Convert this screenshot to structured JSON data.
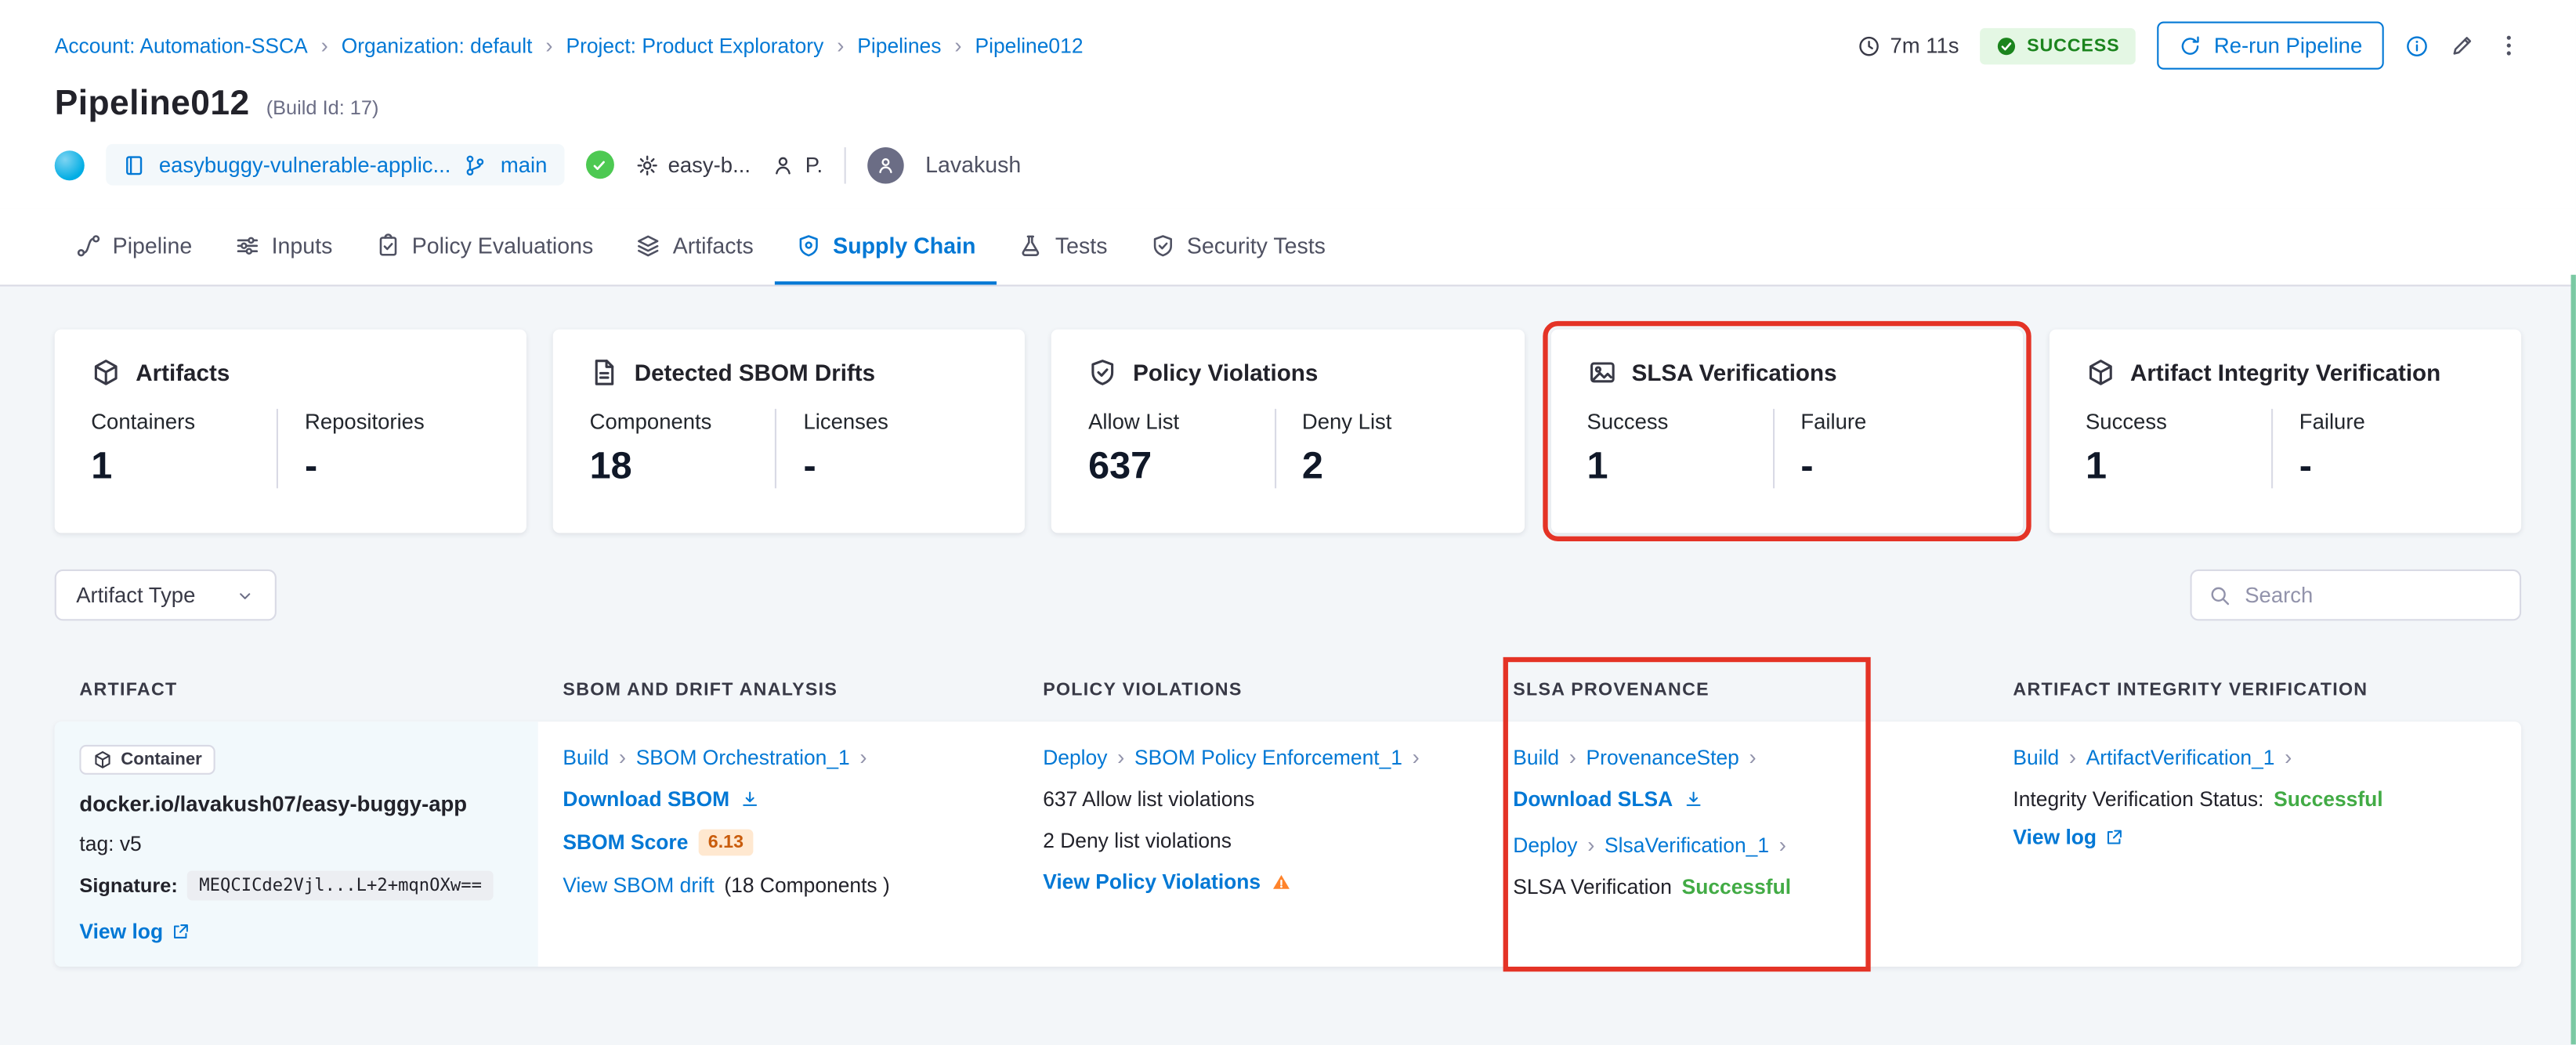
{
  "ui": {
    "chevron": "›"
  },
  "colors": {
    "accent_blue": "#0278d5",
    "success_green": "#42ab45",
    "highlight_red": "#e43326",
    "warning_orange": "#ff832b"
  },
  "breadcrumb": {
    "items": [
      "Account: Automation-SSCA",
      "Organization: default",
      "Project: Product Exploratory",
      "Pipelines",
      "Pipeline012"
    ]
  },
  "header": {
    "duration": "7m 11s",
    "status_badge": "SUCCESS",
    "rerun_button": "Re-run Pipeline",
    "title": "Pipeline012",
    "build_id": "(Build Id: 17)",
    "repo_name": "easybuggy-vulnerable-applic...",
    "branch_name": "main",
    "trigger_label": "easy-b...",
    "trigger_type": "P.",
    "user_name": "Lavakush"
  },
  "tabs": [
    {
      "label": "Pipeline"
    },
    {
      "label": "Inputs"
    },
    {
      "label": "Policy Evaluations"
    },
    {
      "label": "Artifacts"
    },
    {
      "label": "Supply Chain"
    },
    {
      "label": "Tests"
    },
    {
      "label": "Security Tests"
    }
  ],
  "cards": [
    {
      "title": "Artifacts",
      "stats": [
        {
          "label": "Containers",
          "value": "1"
        },
        {
          "label": "Repositories",
          "value": "-"
        }
      ]
    },
    {
      "title": "Detected SBOM Drifts",
      "stats": [
        {
          "label": "Components",
          "value": "18"
        },
        {
          "label": "Licenses",
          "value": "-"
        }
      ]
    },
    {
      "title": "Policy Violations",
      "stats": [
        {
          "label": "Allow List",
          "value": "637"
        },
        {
          "label": "Deny List",
          "value": "2"
        }
      ]
    },
    {
      "title": "SLSA Verifications",
      "stats": [
        {
          "label": "Success",
          "value": "1"
        },
        {
          "label": "Failure",
          "value": "-"
        }
      ]
    },
    {
      "title": "Artifact Integrity Verification",
      "stats": [
        {
          "label": "Success",
          "value": "1"
        },
        {
          "label": "Failure",
          "value": "-"
        }
      ]
    }
  ],
  "filters": {
    "artifact_type": "Artifact Type",
    "search_placeholder": "Search"
  },
  "table": {
    "headers": [
      "ARTIFACT",
      "SBOM AND DRIFT ANALYSIS",
      "POLICY VIOLATIONS",
      "SLSA PROVENANCE",
      "ARTIFACT INTEGRITY VERIFICATION"
    ],
    "row": {
      "artifact": {
        "type_badge": "Container",
        "image": "docker.io/lavakush07/easy-buggy-app",
        "tag": "tag: v5",
        "signature_label": "Signature:",
        "signature_value": "MEQCICde2Vjl...L+2+mqnOXw==",
        "view_log": "View log"
      },
      "sbom": {
        "stage": "Build",
        "step": "SBOM Orchestration_1",
        "download": "Download SBOM",
        "score_label": "SBOM Score",
        "score_value": "6.13",
        "drift_link": "View SBOM drift",
        "drift_suffix": "(18 Components )"
      },
      "policy": {
        "stage": "Deploy",
        "step": "SBOM Policy Enforcement_1",
        "allow": "637 Allow list violations",
        "deny": "2 Deny list violations",
        "view": "View Policy Violations"
      },
      "slsa": {
        "stage1": "Build",
        "step1": "ProvenanceStep",
        "download": "Download SLSA",
        "stage2": "Deploy",
        "step2": "SlsaVerification_1",
        "status_label": "SLSA Verification",
        "status_value": "Successful"
      },
      "integrity": {
        "stage": "Build",
        "step": "ArtifactVerification_1",
        "status_label": "Integrity Verification Status:",
        "status_value": "Successful",
        "view_log": "View log"
      }
    }
  }
}
